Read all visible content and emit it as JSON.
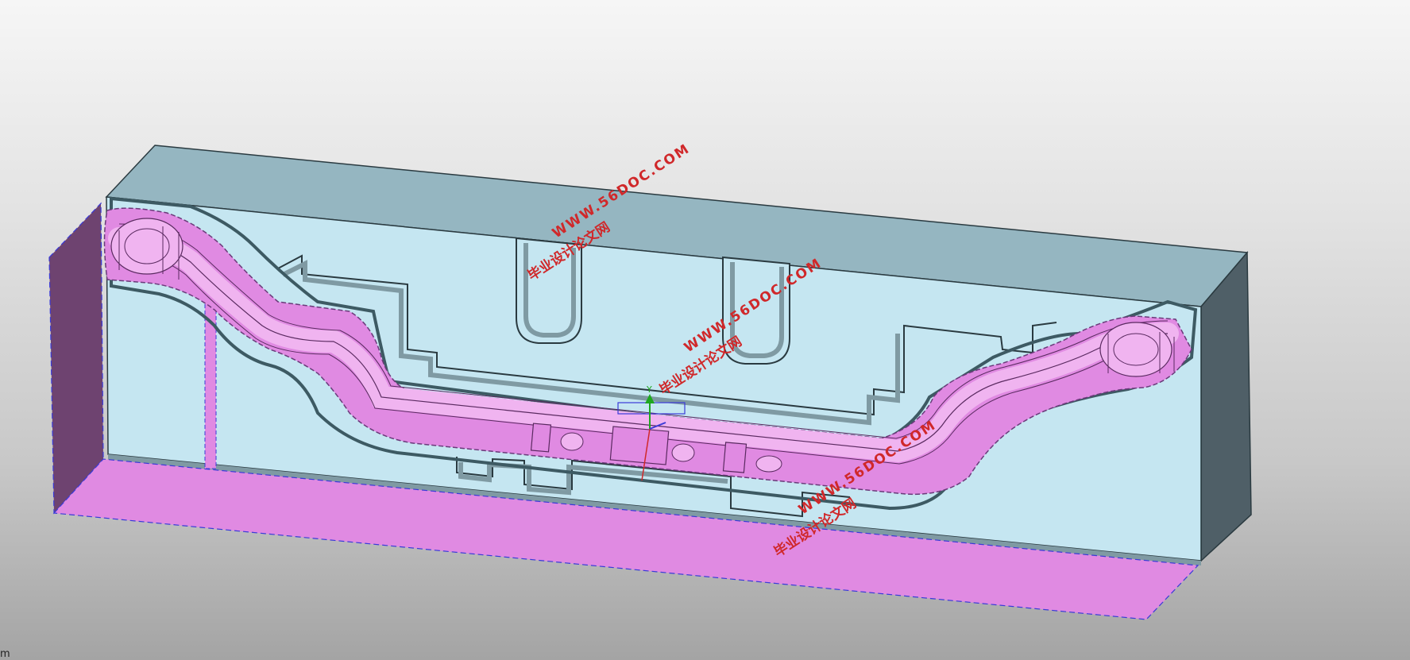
{
  "viewport": {
    "background_top": "#f6f6f6",
    "background_bottom": "#a4a4a4"
  },
  "colors": {
    "mold_face": "#c5e6f1",
    "mold_top": "#95b6c1",
    "mold_side_dark": "#4f5f67",
    "part_magenta": "#e08ae2",
    "part_magenta_light": "#f0b4f0",
    "plane_magenta": "#e08ae2",
    "left_face": "#6e4370",
    "edge_dark": "#2a3a40",
    "dashed_outline": "#3a3ad8",
    "watermark_red": "#d0282a"
  },
  "watermarks": [
    {
      "url": "WWW.56DOC.COM",
      "cn": "毕业设计论文网"
    },
    {
      "url": "WWW.56DOC.COM",
      "cn": "毕业设计论文网"
    },
    {
      "url": "WWW.56DOC.COM",
      "cn": "毕业设计论文网"
    }
  ],
  "triad": {
    "y_label": "Y",
    "icon": "wcs-triad-icon"
  },
  "corner_text": "m"
}
